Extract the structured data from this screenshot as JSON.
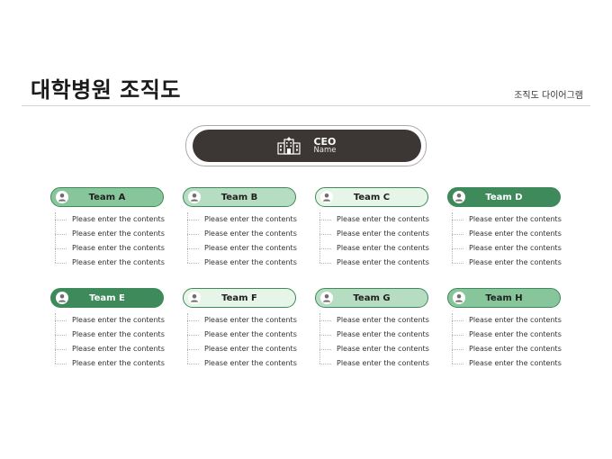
{
  "header": {
    "title": "대학병원 조직도",
    "subtitle": "조직도 다이어그램"
  },
  "ceo": {
    "title": "CEO",
    "name": "Name",
    "icon": "hospital-building-icon",
    "fill": "#3c3735"
  },
  "teams": [
    {
      "name": "Team A",
      "fill": "#86c69a",
      "items": [
        "Please enter the contents",
        "Please enter the contents",
        "Please enter the contents",
        "Please enter the contents"
      ]
    },
    {
      "name": "Team B",
      "fill": "#b6dcc1",
      "items": [
        "Please enter the contents",
        "Please enter the contents",
        "Please enter the contents",
        "Please enter the contents"
      ]
    },
    {
      "name": "Team C",
      "fill": "#e6f5e8",
      "items": [
        "Please enter the contents",
        "Please enter the contents",
        "Please enter the contents",
        "Please enter the contents"
      ]
    },
    {
      "name": "Team D",
      "fill": "#3e8a5a",
      "items": [
        "Please enter the contents",
        "Please enter the contents",
        "Please enter the contents",
        "Please enter the contents"
      ]
    },
    {
      "name": "Team E",
      "fill": "#3e8a5a",
      "items": [
        "Please enter the contents",
        "Please enter the contents",
        "Please enter the contents",
        "Please enter the contents"
      ]
    },
    {
      "name": "Team F",
      "fill": "#e6f5e8",
      "items": [
        "Please enter the contents",
        "Please enter the contents",
        "Please enter the contents",
        "Please enter the contents"
      ]
    },
    {
      "name": "Team G",
      "fill": "#b6dcc1",
      "items": [
        "Please enter the contents",
        "Please enter the contents",
        "Please enter the contents",
        "Please enter the contents"
      ]
    },
    {
      "name": "Team H",
      "fill": "#86c69a",
      "items": [
        "Please enter the contents",
        "Please enter the contents",
        "Please enter the contents",
        "Please enter the contents"
      ]
    }
  ],
  "colors": {
    "pill_border": "#3e8a5a",
    "avatar_glyph": "#6f6f6f",
    "rule": "#d6d6d6"
  }
}
